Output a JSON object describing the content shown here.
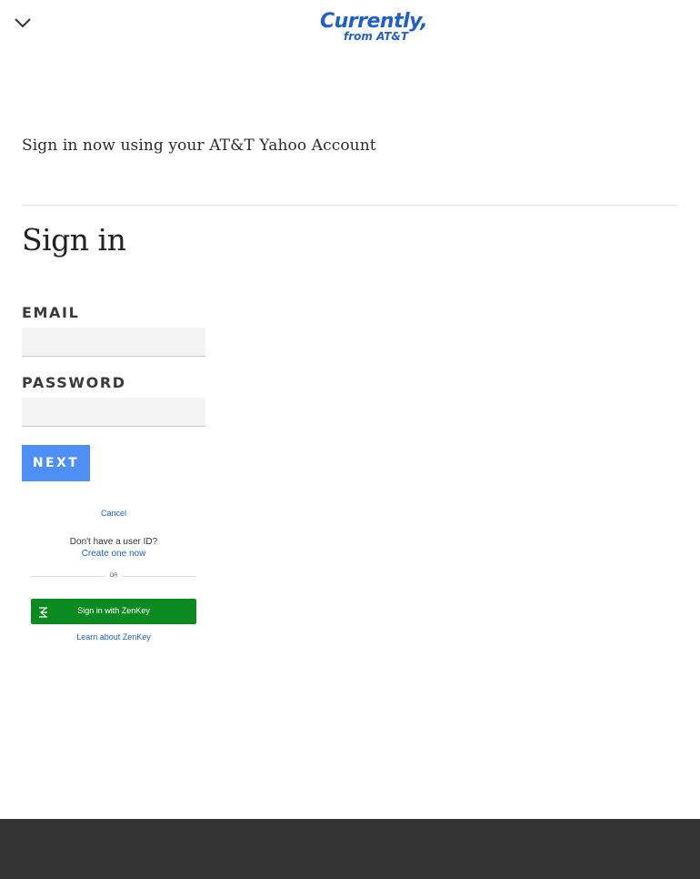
{
  "header": {
    "menu_icon": "chevron-down-icon",
    "logo_title": "Currently,",
    "logo_subtitle": "from AT&T",
    "brand_color": "#1f5fcc"
  },
  "main": {
    "subtitle": "Sign in now using your AT&T Yahoo Account",
    "title": "Sign in",
    "email_label": "Email",
    "email_value": "",
    "password_label": "Password",
    "password_value": "",
    "next_label": "Next",
    "next_color": "#4d8ff5"
  },
  "embed": {
    "cancel_label": "Cancel",
    "no_id_text": "Don't have a user ID?",
    "create_label": "Create one now",
    "or_text": "OR",
    "zenkey_label": "Sign in with ZenKey",
    "zenkey_color": "#0b8a1f",
    "learn_label": "Learn about ZenKey"
  },
  "footer": {
    "color": "#333333"
  }
}
